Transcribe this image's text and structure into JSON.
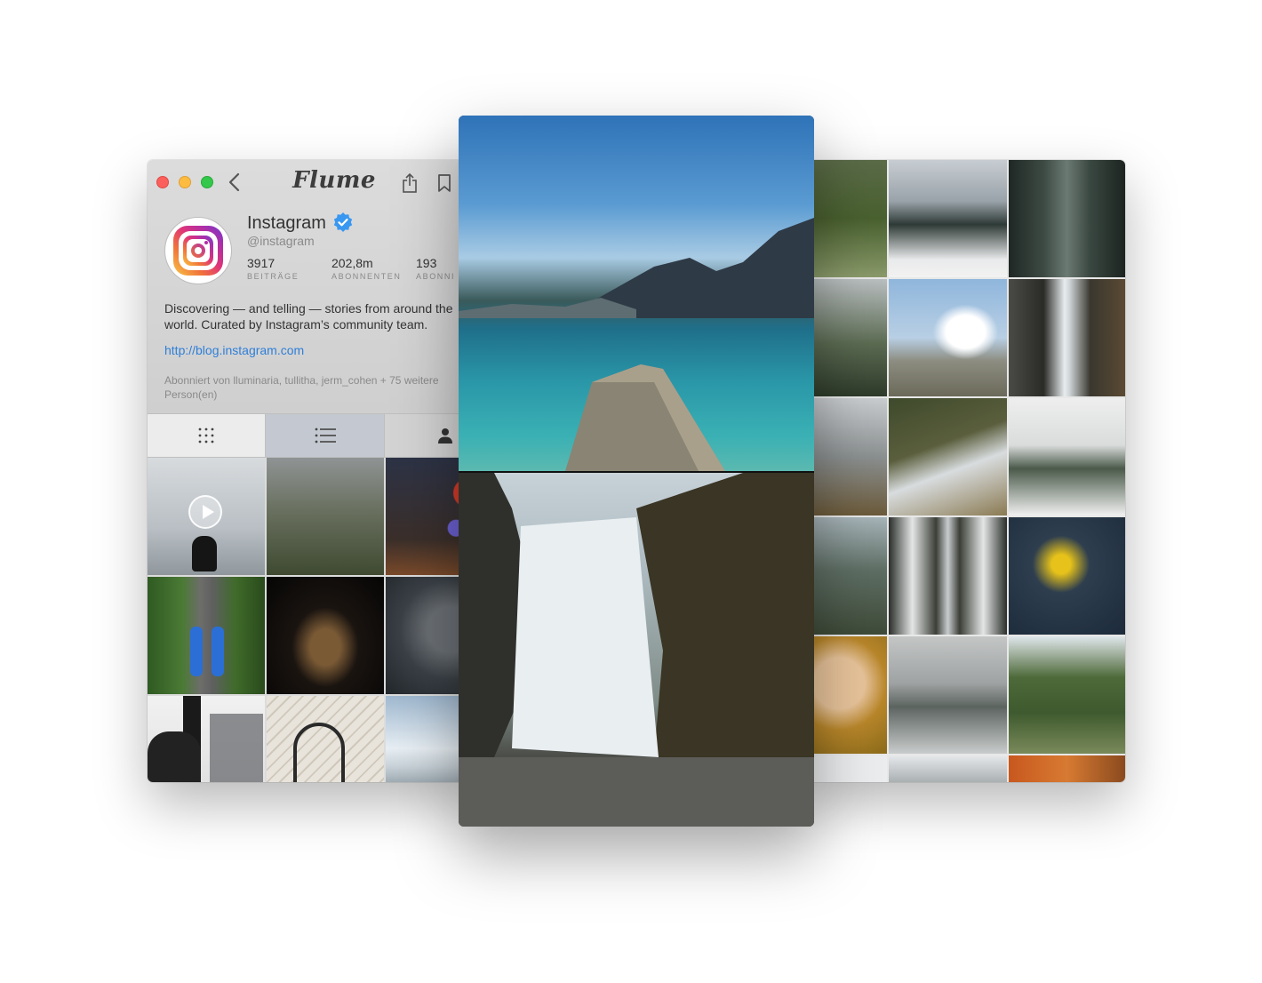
{
  "app": {
    "title": "Flume"
  },
  "profile": {
    "name": "Instagram",
    "handle": "@instagram",
    "stats": [
      {
        "value": "3917",
        "label": "BEITRÄGE"
      },
      {
        "value": "202,8m",
        "label": "ABONNENTEN"
      },
      {
        "value": "193",
        "label": "ABONNI"
      }
    ],
    "bio_line1": "Discovering — and telling — stories from around the",
    "bio_line2": "world. Curated by Instagram’s community team.",
    "website": "http://blog.instagram.com",
    "followed_by_line1": "Abonniert von lluminaria, tullitha, jerm_cohen + 75 weitere",
    "followed_by_line2": "Person(en)"
  },
  "tabs": [
    {
      "icon": "grid-icon"
    },
    {
      "icon": "list-icon"
    },
    {
      "icon": "person-icon"
    }
  ],
  "colors": {
    "accent_link": "#2f7fd8",
    "verified": "#3897f0",
    "close": "#fc605c",
    "minimize": "#fdbc40",
    "zoom": "#34c84a"
  }
}
